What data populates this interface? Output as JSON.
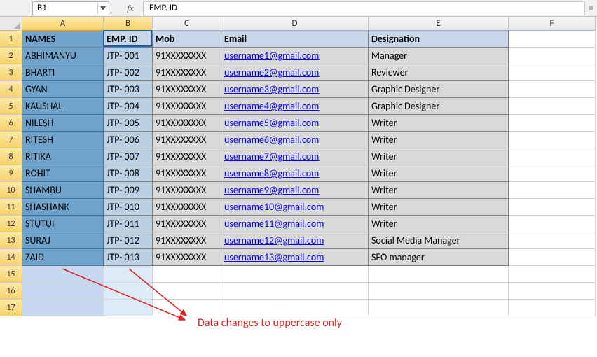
{
  "name_box": "B1",
  "formula_bar_value": "EMP. ID",
  "fx_label": "fx",
  "columns": [
    "A",
    "B",
    "C",
    "D",
    "E",
    "F"
  ],
  "selected_columns": [
    "A",
    "B"
  ],
  "active_cell": "B1",
  "selection_range": "A1:B1048576",
  "headers": {
    "A": "NAMES",
    "B": "EMP. ID",
    "C": "Mob",
    "D": "Email",
    "E": "Designation"
  },
  "rows": [
    {
      "name": "ABHIMANYU",
      "emp": "JTP- 001",
      "mob": "91XXXXXXXX",
      "email": "username1@gmail.com",
      "desig": "Manager"
    },
    {
      "name": "BHARTI",
      "emp": "JTP- 002",
      "mob": "91XXXXXXXX",
      "email": "username2@gmail.com",
      "desig": "Reviewer"
    },
    {
      "name": "GYAN",
      "emp": "JTP- 003",
      "mob": "91XXXXXXXX",
      "email": "username3@gmail.com",
      "desig": "Graphic Designer"
    },
    {
      "name": "KAUSHAL",
      "emp": "JTP- 004",
      "mob": "91XXXXXXXX",
      "email": "username4@gmail.com",
      "desig": "Graphic Designer"
    },
    {
      "name": "NILESH",
      "emp": "JTP- 005",
      "mob": "91XXXXXXXX",
      "email": "username5@gmail.com",
      "desig": "Writer"
    },
    {
      "name": "RITESH",
      "emp": "JTP- 006",
      "mob": "91XXXXXXXX",
      "email": "username6@gmail.com",
      "desig": "Writer"
    },
    {
      "name": "RITIKA",
      "emp": "JTP- 007",
      "mob": "91XXXXXXXX",
      "email": "username7@gmail.com",
      "desig": "Writer"
    },
    {
      "name": "ROHIT",
      "emp": "JTP- 008",
      "mob": "91XXXXXXXX",
      "email": "username8@gmail.com",
      "desig": "Writer"
    },
    {
      "name": "SHAMBU",
      "emp": "JTP- 009",
      "mob": "91XXXXXXXX",
      "email": "username9@gmail.com",
      "desig": "Writer"
    },
    {
      "name": "SHASHANK",
      "emp": "JTP- 010",
      "mob": "91XXXXXXXX",
      "email": "username10@gmail.com",
      "desig": "Writer"
    },
    {
      "name": "STUTUI",
      "emp": "JTP- 011",
      "mob": "91XXXXXXXX",
      "email": "username11@gmail.com",
      "desig": "Writer"
    },
    {
      "name": "SURAJ",
      "emp": "JTP- 012",
      "mob": "91XXXXXXXX",
      "email": "username12@gmail.com",
      "desig": "Social Media Manager"
    },
    {
      "name": "ZAID",
      "emp": "JTP- 013",
      "mob": "91XXXXXXXX",
      "email": "username13@gmail.com",
      "desig": "SEO manager"
    }
  ],
  "empty_rows": [
    15,
    16,
    17
  ],
  "annotation_text": "Data changes to uppercase only"
}
